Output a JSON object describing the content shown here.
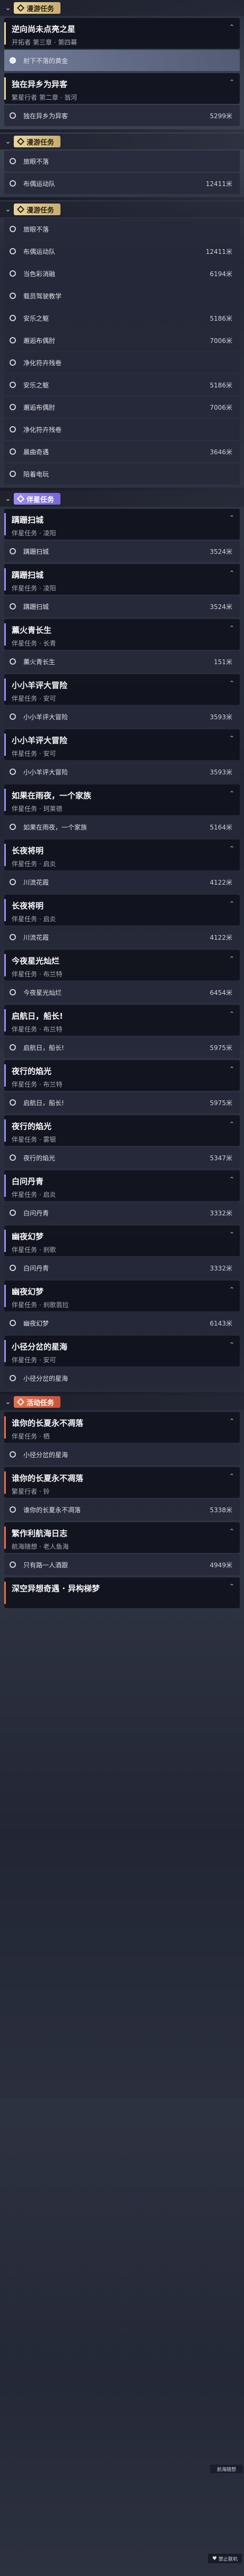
{
  "sections": [
    {
      "kind": "trail",
      "label": "漫游任务",
      "top": 0,
      "quests": [
        {
          "title": "逆向尚未点亮之星",
          "sub": "开拓者 第三章 · 第四幕",
          "steps": [
            {
              "label": "射下不落的黄金",
              "dist": "",
              "active": true
            }
          ]
        },
        {
          "title": "独在异乡为异客",
          "sub": "繁星行者 第二章 · 翁河",
          "steps": [
            {
              "label": "独在异乡为异客",
              "dist": "5299米",
              "active": false
            }
          ]
        }
      ]
    }
  ],
  "section_labels": {
    "trail": "漫游任务",
    "companion": "伴星任务",
    "event": "活动任务"
  },
  "trail_2": {
    "steps": [
      {
        "label": "旅眼不落",
        "dist": "",
        "active": false
      },
      {
        "label": "布偶运动队",
        "dist": "12411米",
        "active": false
      }
    ]
  },
  "trail_3": {
    "steps": [
      {
        "label": "旅眼不落",
        "dist": ""
      },
      {
        "label": "布偶运动队",
        "dist": "12411米"
      },
      {
        "label": "当色彩消融",
        "dist": "6194米"
      },
      {
        "label": "载员驾驶教学",
        "dist": ""
      },
      {
        "label": "安乐之躯",
        "dist": "5186米"
      },
      {
        "label": "邂逅布偶肘",
        "dist": "7006米"
      },
      {
        "label": "净化符卉残卷",
        "dist": ""
      },
      {
        "label": "安乐之躯",
        "dist": "5186米"
      },
      {
        "label": "邂逅布偶肘",
        "dist": "7006米"
      },
      {
        "label": "净化符卉残卷",
        "dist": ""
      },
      {
        "label": "晨曲奇遇",
        "dist": "3646米"
      },
      {
        "label": "陪着电玩",
        "dist": ""
      }
    ]
  },
  "companion": [
    {
      "title": "蹒跚扫城",
      "sub": "伴星任务 · 凌阳",
      "steps": [
        {
          "label": "蹒跚扫城",
          "dist": "3524米"
        }
      ]
    },
    {
      "title": "蹒跚扫城",
      "sub": "伴星任务 · 凌阳",
      "steps": [
        {
          "label": "蹒跚扫城",
          "dist": "3524米"
        }
      ]
    },
    {
      "title": "薰火青长生",
      "sub": "伴星任务 · 长青",
      "steps": [
        {
          "label": "薰火青长生",
          "dist": "151米"
        }
      ]
    },
    {
      "title": "小小羊评大冒险",
      "sub": "伴星任务 · 安可",
      "steps": [
        {
          "label": "小小羊评大冒险",
          "dist": "3593米"
        }
      ]
    },
    {
      "title": "小小羊评大冒险",
      "sub": "伴星任务 · 安可",
      "steps": [
        {
          "label": "小小羊评大冒险",
          "dist": "3593米"
        }
      ]
    },
    {
      "title": "如果在雨夜，一个家族",
      "sub": "伴星任务 · 珂莱德",
      "steps": [
        {
          "label": "如果在雨夜，一个家族",
          "dist": "5164米"
        }
      ]
    },
    {
      "title": "长夜将明",
      "sub": "伴星任务 · 启炎",
      "steps": [
        {
          "label": "川流花霞",
          "dist": "4122米"
        }
      ]
    },
    {
      "title": "长夜将明",
      "sub": "伴星任务 · 启炎",
      "steps": [
        {
          "label": "川流花霞",
          "dist": "4122米"
        }
      ]
    },
    {
      "title": "今夜星光灿烂",
      "sub": "伴星任务 · 布兰特",
      "steps": [
        {
          "label": "今夜星光灿烂",
          "dist": "6454米"
        }
      ]
    },
    {
      "title": "启航日，船长!",
      "sub": "伴星任务 · 布兰特",
      "steps": [
        {
          "label": "启航日，船长!",
          "dist": "5975米"
        }
      ]
    },
    {
      "title": "夜行的焰光",
      "sub": "伴星任务 · 布兰特",
      "steps": [
        {
          "label": "启航日，船长!",
          "dist": "5975米"
        }
      ]
    },
    {
      "title": "夜行的焰光",
      "sub": "伴星任务 · 雾银",
      "steps": [
        {
          "label": "夜行的焰光",
          "dist": "5347米"
        }
      ]
    },
    {
      "title": "白问丹青",
      "sub": "伴星任务 · 启炎",
      "steps": [
        {
          "label": "白问丹青",
          "dist": "3332米"
        }
      ]
    },
    {
      "title": "幽夜幻梦",
      "sub": "伴星任务 · 刹歌",
      "steps": [
        {
          "label": "白问丹青",
          "dist": "3332米"
        }
      ]
    },
    {
      "title": "幽夜幻梦",
      "sub": "伴星任务 · 刹歌翡拉",
      "steps": [
        {
          "label": "幽夜幻梦",
          "dist": "6143米"
        }
      ]
    },
    {
      "title": "小径分岔的星海",
      "sub": "伴星任务 · 安可",
      "steps": [
        {
          "label": "小径分岔的星海",
          "dist": ""
        }
      ]
    }
  ],
  "event": [
    {
      "title": "谁你的长夏永不凋落",
      "sub": "伴星任务 · 栖",
      "steps": [
        {
          "label": "小径分岔的星海",
          "dist": ""
        }
      ]
    },
    {
      "title": "谁你的长夏永不凋落",
      "sub": "繁星行者 · 铃",
      "steps": [
        {
          "label": "谁你的长夏永不凋落",
          "dist": "5338米"
        }
      ]
    },
    {
      "title": "繁作利航海日志",
      "sub": "航海随想 · 老人鱼海",
      "steps": [
        {
          "label": "只有路一人酒跟",
          "dist": "4949米"
        }
      ]
    },
    {
      "title": "深空异想奇遇 · 异构梯梦",
      "sub": "",
      "steps": []
    }
  ],
  "overlay": {
    "tag": "航海随想",
    "badge": "禁止联机"
  },
  "colors": {
    "trail": "#e9d49a",
    "companion": "#9e8cf3",
    "event": "#eb6e4a"
  }
}
